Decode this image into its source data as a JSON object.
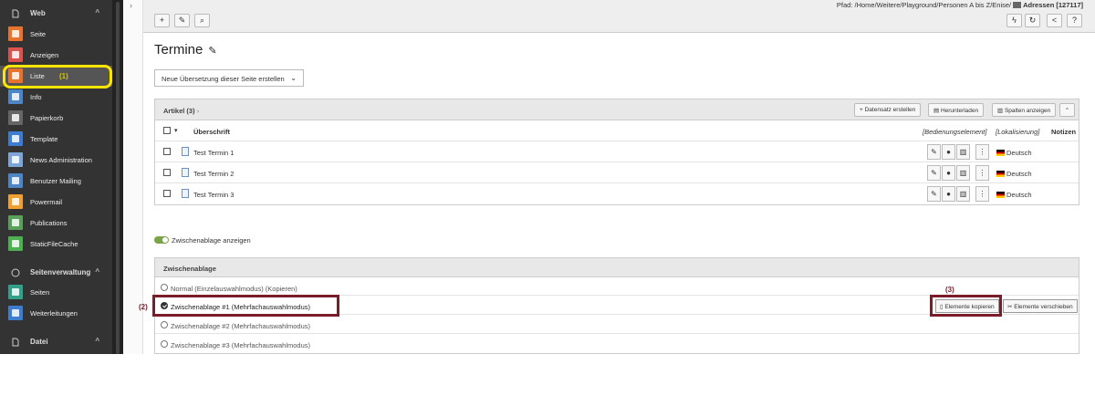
{
  "sidebar": {
    "sections": [
      {
        "label": "Web",
        "icon": "file-icon"
      },
      {
        "label": "Seitenverwaltung",
        "icon": "globe-icon"
      },
      {
        "label": "Datei",
        "icon": "file-icon"
      }
    ],
    "web_items": [
      {
        "label": "Seite",
        "icon": "page-icon",
        "color": "#e8732c"
      },
      {
        "label": "Anzeigen",
        "icon": "eye-icon",
        "color": "#d9534f"
      },
      {
        "label": "Liste",
        "icon": "list-icon",
        "color": "#e8732c"
      },
      {
        "label": "Info",
        "icon": "info-icon",
        "color": "#4e86c5"
      },
      {
        "label": "Papierkorb",
        "icon": "trash-icon",
        "color": "#666666"
      },
      {
        "label": "Template",
        "icon": "template-icon",
        "color": "#3d7ccf"
      },
      {
        "label": "News Administration",
        "icon": "news-icon",
        "color": "#7ea5d8"
      },
      {
        "label": "Benutzer Mailing",
        "icon": "mailing-icon",
        "color": "#4e86c5"
      },
      {
        "label": "Powermail",
        "icon": "at-icon",
        "color": "#f0a030"
      },
      {
        "label": "Publications",
        "icon": "book-icon",
        "color": "#5aa05a"
      },
      {
        "label": "StaticFileCache",
        "icon": "cache-icon",
        "color": "#4caf50"
      }
    ],
    "seiten_items": [
      {
        "label": "Seiten",
        "icon": "pages-icon",
        "color": "#34a08a"
      },
      {
        "label": "Weiterleitungen",
        "icon": "redirect-icon",
        "color": "#3d7ccf"
      }
    ]
  },
  "annotations": {
    "one": "(1)",
    "two": "(2)",
    "three": "(3)"
  },
  "header": {
    "path_prefix": "Pfad: /Home/Weitere/Playground/Personen A bis Z/Enise/",
    "path_page": "Adressen [127117]",
    "left_buttons": [
      {
        "icon": "plus-icon",
        "glyph": "+"
      },
      {
        "icon": "edit-icon",
        "glyph": "✎"
      },
      {
        "icon": "search-icon",
        "glyph": "⌕"
      }
    ],
    "right_buttons": [
      {
        "icon": "bolt-icon",
        "glyph": "ϟ"
      },
      {
        "icon": "refresh-icon",
        "glyph": "↻"
      },
      {
        "icon": "share-icon",
        "glyph": "<"
      },
      {
        "icon": "help-icon",
        "glyph": "?"
      }
    ]
  },
  "page": {
    "title": "Termine",
    "translation_select": "Neue Übersetzung dieser Seite erstellen"
  },
  "articles": {
    "heading": "Artikel (3)",
    "create_label": "Datensatz erstellen",
    "download_label": "Herunterladen",
    "columns_label": "Spalten anzeigen",
    "columns": {
      "headline": "Überschrift",
      "control": "[Bedienungselement]",
      "localization": "[Lokalisierung]",
      "notes": "Notizen"
    },
    "rows": [
      {
        "title": "Test Termin 1",
        "language": "Deutsch"
      },
      {
        "title": "Test Termin 2",
        "language": "Deutsch"
      },
      {
        "title": "Test Termin 3",
        "language": "Deutsch"
      }
    ]
  },
  "clipboard": {
    "toggle_label": "Zwischenablage anzeigen",
    "heading": "Zwischenablage",
    "options": [
      {
        "label": "Normal (Einzelauswahlmodus) (Kopieren)",
        "selected": false
      },
      {
        "label": "Zwischenablage #1 (Mehrfachauswahlmodus)",
        "selected": true
      },
      {
        "label": "Zwischenablage #2 (Mehrfachauswahlmodus)",
        "selected": false
      },
      {
        "label": "Zwischenablage #3 (Mehrfachauswahlmodus)",
        "selected": false
      }
    ],
    "copy_label": "Elemente kopieren",
    "move_label": "Elemente verschieben"
  },
  "colors": {
    "highlight_yellow": "#ffe600",
    "annotation_red": "#7b1c2a",
    "toggle_green": "#79a548"
  }
}
